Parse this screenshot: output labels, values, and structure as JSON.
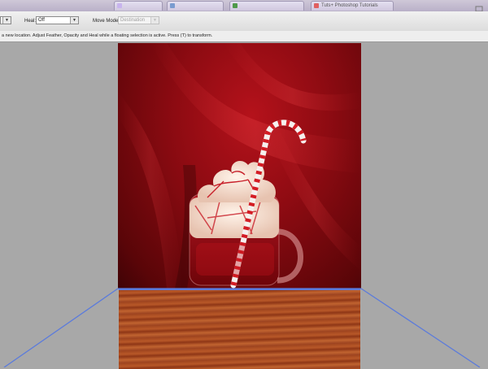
{
  "browser": {
    "tabs": [
      {
        "label": "",
        "color": "#c8b4ee"
      },
      {
        "label": "",
        "color": "#7a9cd0"
      },
      {
        "label": "",
        "color": "#4f9a4a"
      },
      {
        "label": "Tuts+ Photoshop Tutorials",
        "color": "#e06060"
      }
    ]
  },
  "options": {
    "heal_label": "Heal:",
    "heal_value": "Off",
    "move_mode_label": "Move Mode:",
    "move_mode_value": "Destination"
  },
  "hint": {
    "text": "a new location. Adjust Feather, Opacity and Heal while a floating selection is active. Press (T) to transform."
  },
  "colors": {
    "selection_line": "#5b7bdc",
    "background_red": "#8e0b12",
    "workspace_gray": "#a8a8a8"
  }
}
